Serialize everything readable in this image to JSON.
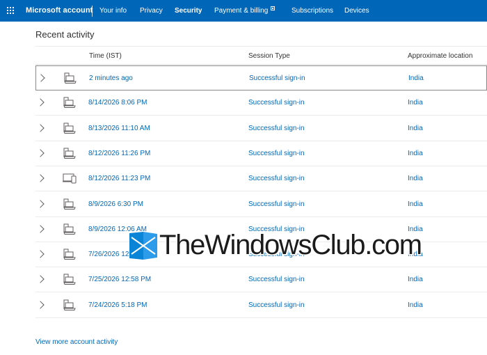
{
  "header": {
    "brand": "Microsoft account",
    "nav": [
      "Your info",
      "Privacy",
      "Security",
      "Payment & billing",
      "Subscriptions",
      "Devices"
    ],
    "active": "Security",
    "accent": "#0067b8"
  },
  "section": {
    "title": "Recent activity"
  },
  "table": {
    "columns": [
      "Time (IST)",
      "Session Type",
      "Approximate location"
    ],
    "rows": [
      {
        "time": "2 minutes ago",
        "session": "Successful sign-in",
        "location": "India",
        "device": "laptop-icon"
      },
      {
        "time": "8/14/2026 8:06 PM",
        "session": "Successful sign-in",
        "location": "India",
        "device": "laptop-icon"
      },
      {
        "time": "8/13/2026 11:10 AM",
        "session": "Successful sign-in",
        "location": "India",
        "device": "laptop-icon"
      },
      {
        "time": "8/12/2026 11:26 PM",
        "session": "Successful sign-in",
        "location": "India",
        "device": "laptop-icon"
      },
      {
        "time": "8/12/2026 11:23 PM",
        "session": "Successful sign-in",
        "location": "India",
        "device": "multi-device-icon"
      },
      {
        "time": "8/9/2026 6:30 PM",
        "session": "Successful sign-in",
        "location": "India",
        "device": "laptop-icon"
      },
      {
        "time": "8/9/2026 12:06 AM",
        "session": "Successful sign-in",
        "location": "India",
        "device": "laptop-icon"
      },
      {
        "time": "7/26/2026 12:...",
        "session": "Successful sign-in",
        "location": "India",
        "device": "laptop-icon"
      },
      {
        "time": "7/25/2026 12:58 PM",
        "session": "Successful sign-in",
        "location": "India",
        "device": "laptop-icon"
      },
      {
        "time": "7/24/2026 5:18 PM",
        "session": "Successful sign-in",
        "location": "India",
        "device": "laptop-icon"
      }
    ]
  },
  "footer": {
    "more_link": "View more account activity"
  },
  "watermark": {
    "text": "TheWindowsClub.com"
  }
}
